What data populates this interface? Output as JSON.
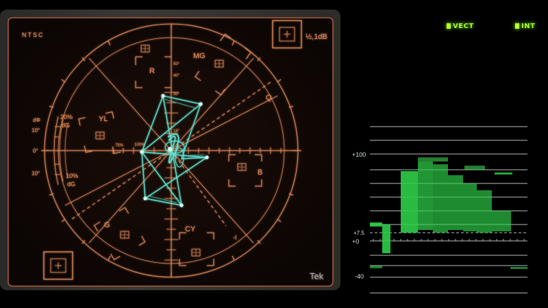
{
  "vectorscope": {
    "mode_label": "NTSC",
    "gain_label": "½,1dB",
    "brand": "Tek",
    "targets": {
      "r": "R",
      "mg": "MG",
      "b": "B",
      "cy": "CY",
      "g": "G",
      "yl": "YL"
    },
    "axis_labels": {
      "q": "Q",
      "minus_i": "-I"
    },
    "degree_labels": [
      "50°",
      "40°",
      "30°",
      "18°"
    ],
    "percent_labels": [
      "75%",
      "100%"
    ],
    "dg_labels": [
      "dΦ",
      "10°",
      "0°",
      "10°"
    ],
    "dg_pct_top": "20%",
    "dg_top": "dG",
    "dg_pct_bottom": "10%",
    "dg_bottom": "dG"
  },
  "indicators": {
    "vect": "VECT",
    "int": "INT",
    "color": "#a6ff2a"
  },
  "waveform": {
    "scale_labels": {
      "top": "+100",
      "setup": "+7.5",
      "zero": "+0",
      "bottom": "-40"
    },
    "trace_color": "#3ee65a"
  },
  "colors": {
    "graticule": "#e08a5a",
    "trace": "#5fe8d4",
    "waveform_grid": "#d8e2e0"
  }
}
